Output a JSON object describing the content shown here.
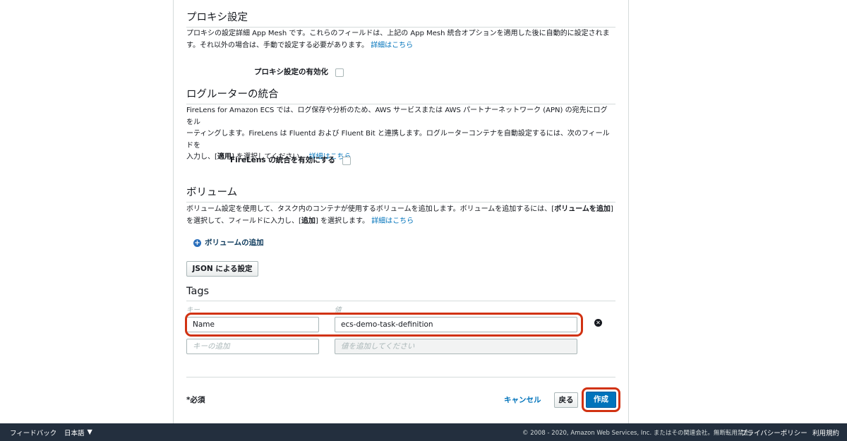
{
  "proxy": {
    "title": "プロキシ設定",
    "desc_line1": "プロキシの設定詳細 App Mesh です。これらのフィールドは、上記の App Mesh 統合オプションを適用した後に自動的に設定されま",
    "desc_line2": "す。それ以外の場合は、手動で設定する必要があります。",
    "learn_more": "詳細はこちら",
    "enable_label": "プロキシ設定の有効化"
  },
  "logrouter": {
    "title": "ログルーターの統合",
    "desc_line1": "FireLens for Amazon ECS では、ログ保存や分析のため、AWS サービスまたは AWS パートナーネットワーク (APN) の宛先にログをル",
    "desc_line2": "ーティングします。FireLens は Fluentd および Fluent Bit と連携します。ログルーターコンテナを自動設定するには、次のフィールドを",
    "desc_line3_pre": "入力し、[",
    "desc_line3_bold": "適用",
    "desc_line3_post": "] を選択してください。",
    "learn_more": "詳細はこちら",
    "enable_label": "FireLens の統合を有効にする"
  },
  "volumes": {
    "title": "ボリューム",
    "desc_line1_pre": "ボリューム設定を使用して、タスク内のコンテナが使用するボリュームを追加します。ボリュームを追加するには、[",
    "desc_line1_bold": "ボリュームを追加",
    "desc_line1_post": "]",
    "desc_line2_pre": "を選択して、フィールドに入力し、[",
    "desc_line2_bold": "追加",
    "desc_line2_post": "] を選択します。",
    "learn_more": "詳細はこちら",
    "add_volume": "ボリュームの追加",
    "json_button": "JSON による設定"
  },
  "tags": {
    "title": "Tags",
    "key_header": "キー",
    "value_header": "値",
    "rows": [
      {
        "key": "Name",
        "value": "ecs-demo-task-definition"
      }
    ],
    "key_placeholder": "キーの追加",
    "value_placeholder": "値を追加してください"
  },
  "actions": {
    "required": "*必須",
    "cancel": "キャンセル",
    "back": "戻る",
    "create": "作成"
  },
  "footer": {
    "feedback": "フィードバック",
    "language": "日本語",
    "copyright": "© 2008 - 2020, Amazon Web Services, Inc. またはその関連会社。無断転用禁止。",
    "privacy": "プライバシーポリシー",
    "terms": "利用規約"
  },
  "colors": {
    "link": "#0073bb",
    "primary": "#0073bb",
    "highlight": "#d13212",
    "footer_bg": "#232f3e"
  }
}
